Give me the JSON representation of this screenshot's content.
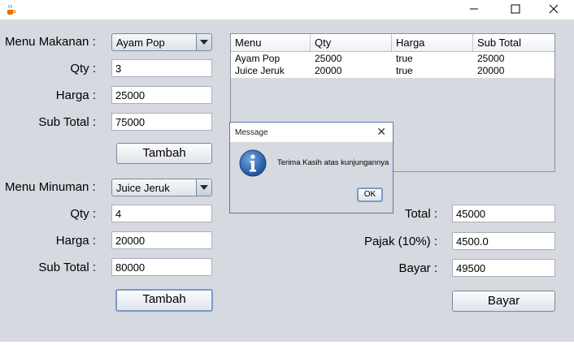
{
  "window": {
    "icon": "java-coffee-icon",
    "controls": [
      "minimize-icon",
      "maximize-icon",
      "close-icon"
    ]
  },
  "food": {
    "menu_label": "Menu Makanan :",
    "menu_selected": "Ayam Pop",
    "qty_label": "Qty :",
    "qty_value": "3",
    "price_label": "Harga :",
    "price_value": "25000",
    "subtotal_label": "Sub Total :",
    "subtotal_value": "75000",
    "add_button": "Tambah"
  },
  "drink": {
    "menu_label": "Menu Minuman :",
    "menu_selected": "Juice Jeruk",
    "qty_label": "Qty :",
    "qty_value": "4",
    "price_label": "Harga :",
    "price_value": "20000",
    "subtotal_label": "Sub Total :",
    "subtotal_value": "80000",
    "add_button": "Tambah"
  },
  "table": {
    "columns": [
      "Menu",
      "Qty",
      "Harga",
      "Sub Total"
    ],
    "rows": [
      [
        "Ayam Pop",
        "25000",
        "true",
        "25000"
      ],
      [
        "Juice Jeruk",
        "20000",
        "true",
        "20000"
      ]
    ]
  },
  "summary": {
    "total_label": "Total :",
    "total_value": "45000",
    "tax_label": "Pajak (10%) :",
    "tax_value": "4500.0",
    "pay_label": "Bayar :",
    "pay_value": "49500",
    "pay_button": "Bayar"
  },
  "dialog": {
    "title": "Message",
    "icon": "info-icon",
    "message": "Terima Kasih atas kunjungannya",
    "ok_button": "OK"
  }
}
